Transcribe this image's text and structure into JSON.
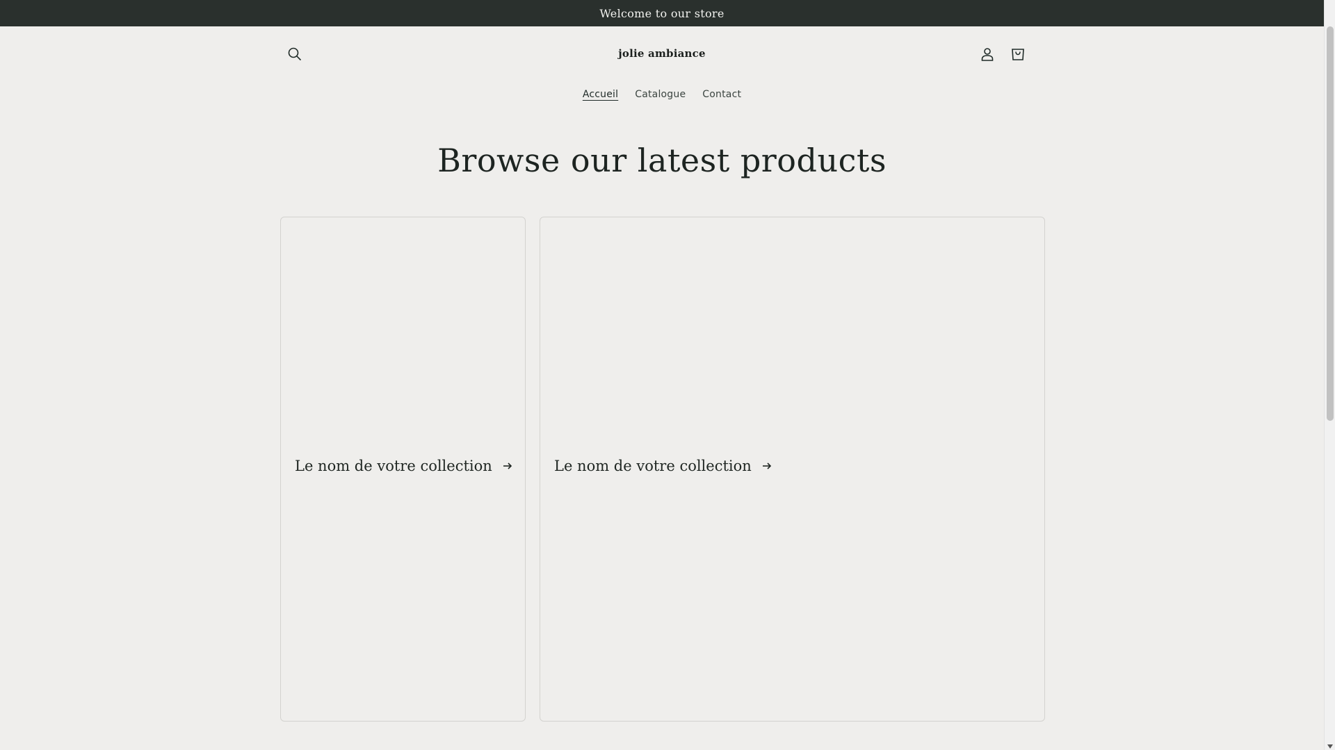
{
  "announcement": {
    "text": "Welcome to our store"
  },
  "header": {
    "logo_text": "jolie ambiance",
    "icons": {
      "search": "search-icon",
      "account": "user-icon",
      "cart": "cart-icon"
    }
  },
  "nav": {
    "items": [
      {
        "label": "Accueil",
        "active": true
      },
      {
        "label": "Catalogue",
        "active": false
      },
      {
        "label": "Contact",
        "active": false
      }
    ]
  },
  "main": {
    "heading": "Browse our latest products",
    "collections": [
      {
        "title": "Le nom de votre collection",
        "icon": "arrow-right-icon"
      },
      {
        "title": "Le nom de votre collection",
        "icon": "arrow-right-icon"
      }
    ]
  },
  "colors": {
    "background": "#efeeec",
    "announcement_bg": "#2a302d",
    "announcement_text": "#f2f2ef",
    "text": "#1f2a27",
    "card_border": "#d3d2cf"
  }
}
